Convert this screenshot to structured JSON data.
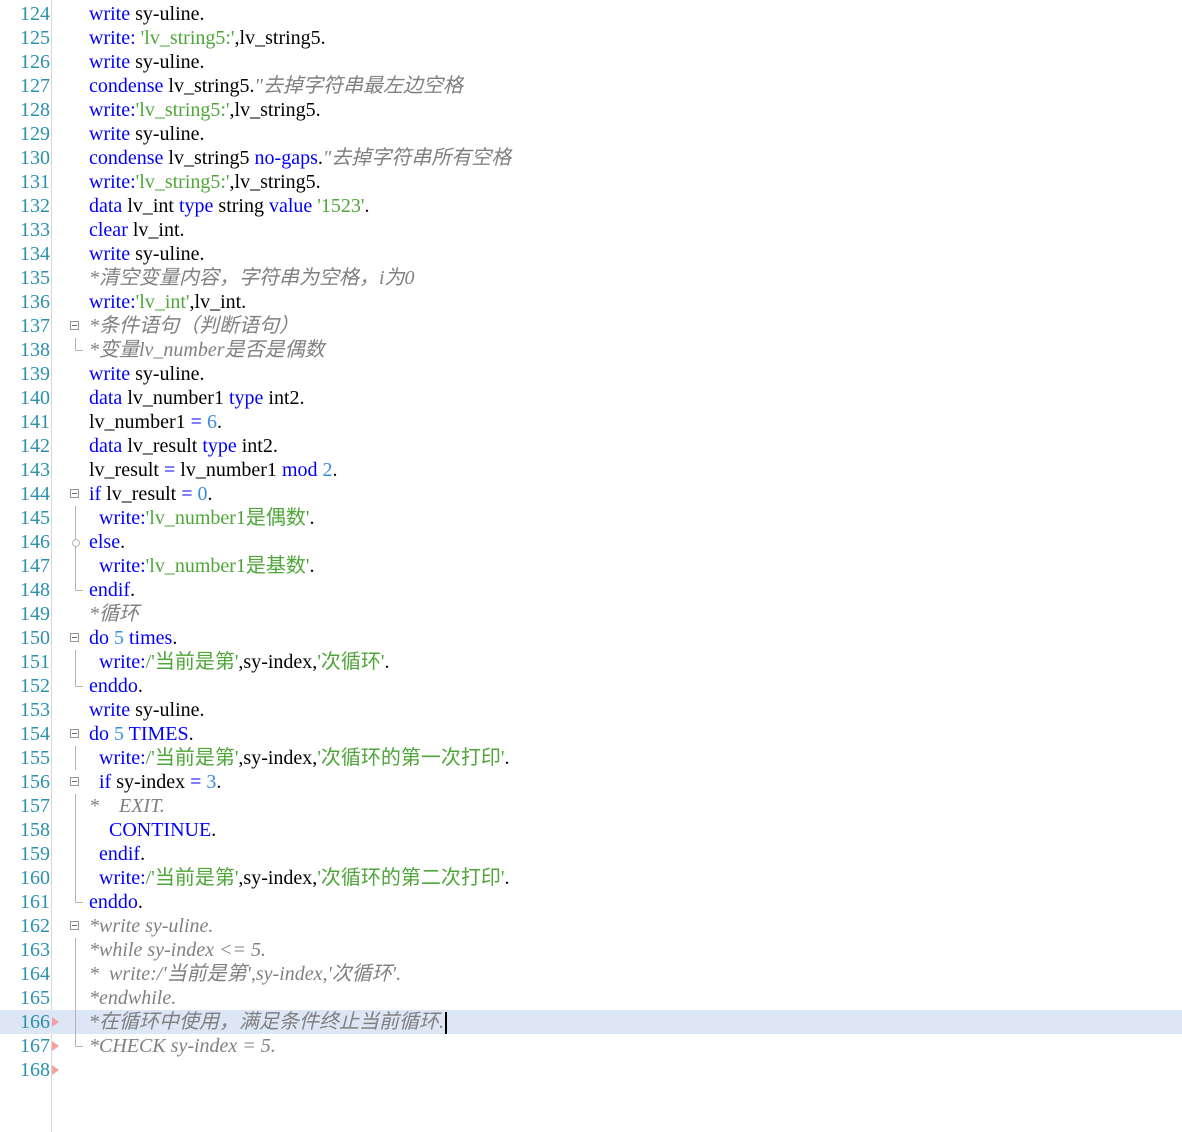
{
  "editor": {
    "lines": [
      {
        "n": "124",
        "segs": [
          {
            "t": "write",
            "c": "kw"
          },
          {
            "t": " sy-uline."
          }
        ]
      },
      {
        "n": "125",
        "segs": [
          {
            "t": "write:",
            "c": "kw"
          },
          {
            "t": " "
          },
          {
            "t": "'lv_string5:'",
            "c": "str"
          },
          {
            "t": ",lv_string5."
          }
        ]
      },
      {
        "n": "126",
        "segs": [
          {
            "t": "write",
            "c": "kw"
          },
          {
            "t": " sy-uline."
          }
        ]
      },
      {
        "n": "127",
        "segs": [
          {
            "t": "condense",
            "c": "kw"
          },
          {
            "t": " lv_string5."
          },
          {
            "t": "\"去掉字符串最左边空格",
            "c": "cm"
          }
        ]
      },
      {
        "n": "128",
        "segs": [
          {
            "t": "write:",
            "c": "kw"
          },
          {
            "t": "'lv_string5:'",
            "c": "str"
          },
          {
            "t": ",lv_string5."
          }
        ]
      },
      {
        "n": "129",
        "segs": [
          {
            "t": "write",
            "c": "kw"
          },
          {
            "t": " sy-uline."
          }
        ]
      },
      {
        "n": "130",
        "segs": [
          {
            "t": "condense",
            "c": "kw"
          },
          {
            "t": " lv_string5 "
          },
          {
            "t": "no-gaps",
            "c": "kw"
          },
          {
            "t": "."
          },
          {
            "t": "\"去掉字符串所有空格",
            "c": "cm"
          }
        ]
      },
      {
        "n": "131",
        "segs": [
          {
            "t": "write:",
            "c": "kw"
          },
          {
            "t": "'lv_string5:'",
            "c": "str"
          },
          {
            "t": ",lv_string5."
          }
        ]
      },
      {
        "n": "132",
        "segs": [
          {
            "t": "data",
            "c": "kw"
          },
          {
            "t": " lv_int "
          },
          {
            "t": "type",
            "c": "kw"
          },
          {
            "t": " string "
          },
          {
            "t": "value",
            "c": "kw"
          },
          {
            "t": " "
          },
          {
            "t": "'1523'",
            "c": "str"
          },
          {
            "t": "."
          }
        ]
      },
      {
        "n": "133",
        "segs": [
          {
            "t": "clear",
            "c": "kw"
          },
          {
            "t": " lv_int."
          }
        ]
      },
      {
        "n": "134",
        "segs": [
          {
            "t": "write",
            "c": "kw"
          },
          {
            "t": " sy-uline."
          }
        ]
      },
      {
        "n": "135",
        "segs": [
          {
            "t": "*清空变量内容，字符串为空格，i为0",
            "c": "cm"
          }
        ]
      },
      {
        "n": "136",
        "segs": [
          {
            "t": "write:",
            "c": "kw"
          },
          {
            "t": "'lv_int'",
            "c": "str"
          },
          {
            "t": ",lv_int."
          }
        ]
      },
      {
        "n": "137",
        "fold": "box",
        "segs": [
          {
            "t": "*条件语句（判断语句）",
            "c": "cm"
          }
        ]
      },
      {
        "n": "138",
        "fold": "end",
        "segs": [
          {
            "t": "*变量lv_number是否是偶数",
            "c": "cm"
          }
        ]
      },
      {
        "n": "139",
        "segs": [
          {
            "t": "write",
            "c": "kw"
          },
          {
            "t": " sy-uline."
          }
        ]
      },
      {
        "n": "140",
        "segs": [
          {
            "t": "data",
            "c": "kw"
          },
          {
            "t": " lv_number1 "
          },
          {
            "t": "type",
            "c": "kw"
          },
          {
            "t": " int2."
          }
        ]
      },
      {
        "n": "141",
        "segs": [
          {
            "t": "lv_number1 "
          },
          {
            "t": "=",
            "c": "kw"
          },
          {
            "t": " "
          },
          {
            "t": "6",
            "c": "num"
          },
          {
            "t": "."
          }
        ]
      },
      {
        "n": "142",
        "segs": [
          {
            "t": "data",
            "c": "kw"
          },
          {
            "t": " lv_result "
          },
          {
            "t": "type",
            "c": "kw"
          },
          {
            "t": " int2."
          }
        ]
      },
      {
        "n": "143",
        "segs": [
          {
            "t": "lv_result "
          },
          {
            "t": "=",
            "c": "kw"
          },
          {
            "t": " lv_number1 "
          },
          {
            "t": "mod",
            "c": "kw"
          },
          {
            "t": " "
          },
          {
            "t": "2",
            "c": "num"
          },
          {
            "t": "."
          }
        ]
      },
      {
        "n": "144",
        "fold": "box",
        "segs": [
          {
            "t": "if",
            "c": "kw"
          },
          {
            "t": " lv_result "
          },
          {
            "t": "=",
            "c": "kw"
          },
          {
            "t": " "
          },
          {
            "t": "0",
            "c": "num"
          },
          {
            "t": "."
          }
        ]
      },
      {
        "n": "145",
        "fold": "line",
        "segs": [
          {
            "t": "  "
          },
          {
            "t": "write:",
            "c": "kw"
          },
          {
            "t": "'lv_number1是偶数'",
            "c": "str"
          },
          {
            "t": "."
          }
        ]
      },
      {
        "n": "146",
        "fold": "mid",
        "segs": [
          {
            "t": "else",
            "c": "kw"
          },
          {
            "t": "."
          }
        ]
      },
      {
        "n": "147",
        "fold": "line",
        "segs": [
          {
            "t": "  "
          },
          {
            "t": "write:",
            "c": "kw"
          },
          {
            "t": "'lv_number1是基数'",
            "c": "str"
          },
          {
            "t": "."
          }
        ]
      },
      {
        "n": "148",
        "fold": "end",
        "segs": [
          {
            "t": "endif",
            "c": "kw"
          },
          {
            "t": "."
          }
        ]
      },
      {
        "n": "149",
        "segs": [
          {
            "t": "*循环",
            "c": "cm"
          }
        ]
      },
      {
        "n": "150",
        "fold": "box",
        "segs": [
          {
            "t": "do",
            "c": "kw"
          },
          {
            "t": " "
          },
          {
            "t": "5",
            "c": "num"
          },
          {
            "t": " "
          },
          {
            "t": "times",
            "c": "kw"
          },
          {
            "t": "."
          }
        ]
      },
      {
        "n": "151",
        "fold": "line",
        "segs": [
          {
            "t": "  "
          },
          {
            "t": "write:",
            "c": "kw"
          },
          {
            "t": "/'当前是第'",
            "c": "str"
          },
          {
            "t": ",sy-index,"
          },
          {
            "t": "'次循环'",
            "c": "str"
          },
          {
            "t": "."
          }
        ]
      },
      {
        "n": "152",
        "fold": "end",
        "segs": [
          {
            "t": "enddo",
            "c": "kw"
          },
          {
            "t": "."
          }
        ]
      },
      {
        "n": "153",
        "segs": [
          {
            "t": "write",
            "c": "kw"
          },
          {
            "t": " sy-uline."
          }
        ]
      },
      {
        "n": "154",
        "fold": "box",
        "segs": [
          {
            "t": "do",
            "c": "kw"
          },
          {
            "t": " "
          },
          {
            "t": "5",
            "c": "num"
          },
          {
            "t": " "
          },
          {
            "t": "TIMES",
            "c": "kw"
          },
          {
            "t": "."
          }
        ]
      },
      {
        "n": "155",
        "fold": "line",
        "segs": [
          {
            "t": "  "
          },
          {
            "t": "write:",
            "c": "kw"
          },
          {
            "t": "/'当前是第'",
            "c": "str"
          },
          {
            "t": ",sy-index,"
          },
          {
            "t": "'次循环的第一次打印'",
            "c": "str"
          },
          {
            "t": "."
          }
        ]
      },
      {
        "n": "156",
        "fold": "box",
        "segs": [
          {
            "t": "  "
          },
          {
            "t": "if",
            "c": "kw"
          },
          {
            "t": " sy-index "
          },
          {
            "t": "=",
            "c": "kw"
          },
          {
            "t": " "
          },
          {
            "t": "3",
            "c": "num"
          },
          {
            "t": "."
          }
        ]
      },
      {
        "n": "157",
        "fold": "line",
        "segs": [
          {
            "t": "*    EXIT.",
            "c": "cm"
          }
        ]
      },
      {
        "n": "158",
        "fold": "line",
        "segs": [
          {
            "t": "    "
          },
          {
            "t": "CONTINUE",
            "c": "kw"
          },
          {
            "t": "."
          }
        ]
      },
      {
        "n": "159",
        "fold": "line",
        "segs": [
          {
            "t": "  "
          },
          {
            "t": "endif",
            "c": "kw"
          },
          {
            "t": "."
          }
        ]
      },
      {
        "n": "160",
        "fold": "line",
        "segs": [
          {
            "t": "  "
          },
          {
            "t": "write:",
            "c": "kw"
          },
          {
            "t": "/'当前是第'",
            "c": "str"
          },
          {
            "t": ",sy-index,"
          },
          {
            "t": "'次循环的第二次打印'",
            "c": "str"
          },
          {
            "t": "."
          }
        ]
      },
      {
        "n": "161",
        "fold": "end",
        "segs": [
          {
            "t": "enddo",
            "c": "kw"
          },
          {
            "t": "."
          }
        ]
      },
      {
        "n": "162",
        "fold": "box",
        "segs": [
          {
            "t": "*write sy-uline.",
            "c": "cm"
          }
        ]
      },
      {
        "n": "163",
        "fold": "line",
        "segs": [
          {
            "t": "*while sy-index <= 5.",
            "c": "cm"
          }
        ]
      },
      {
        "n": "164",
        "fold": "line",
        "segs": [
          {
            "t": "*  write:/'当前是第',sy-index,'次循环'.",
            "c": "cm"
          }
        ]
      },
      {
        "n": "165",
        "fold": "line",
        "segs": [
          {
            "t": "*endwhile.",
            "c": "cm"
          }
        ]
      },
      {
        "n": "166",
        "fold": "line",
        "marker": true,
        "current": true,
        "segs": [
          {
            "t": "*在循环中使用，满足条件终止当前循环.",
            "c": "cm"
          }
        ]
      },
      {
        "n": "167",
        "fold": "end",
        "marker": true,
        "segs": [
          {
            "t": "*CHECK sy-index = 5.",
            "c": "cm"
          }
        ]
      },
      {
        "n": "168",
        "marker": true,
        "segs": []
      }
    ]
  }
}
